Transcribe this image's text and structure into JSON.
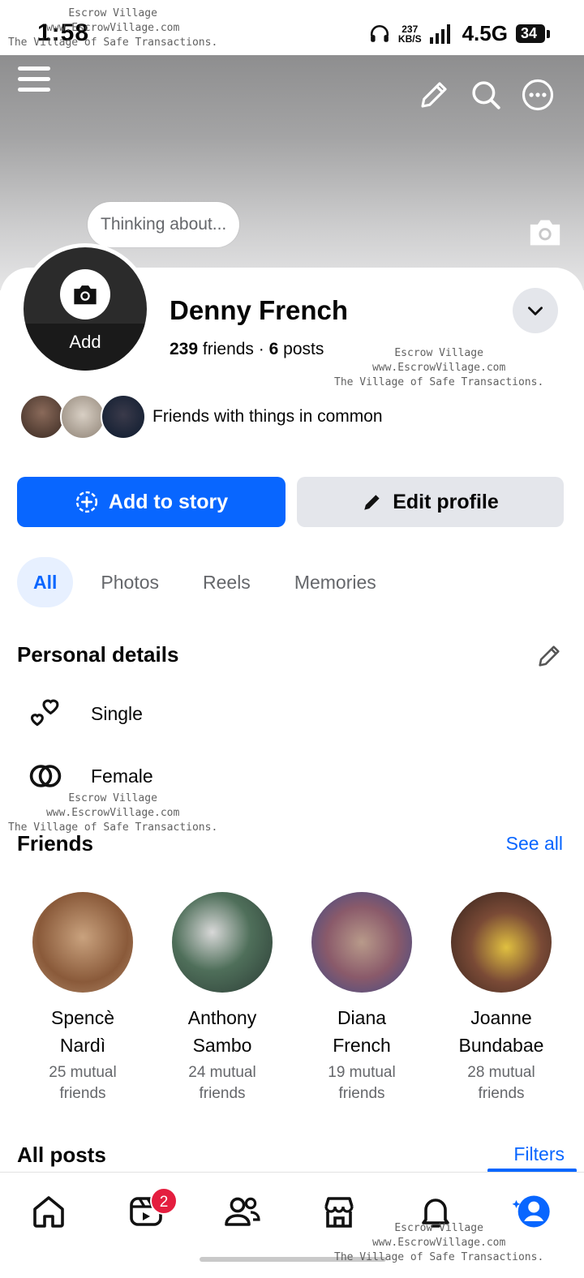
{
  "status_bar": {
    "time": "1:58",
    "speed": "237",
    "speed_unit": "KB/S",
    "network": "4.5G",
    "battery": "34"
  },
  "watermark": {
    "line1": "Escrow Village",
    "line2": "www.EscrowVillage.com",
    "line3": "The Village of Safe Transactions."
  },
  "cover": {
    "thought_placeholder": "Thinking about..."
  },
  "profile": {
    "avatar_label": "Add",
    "name": "Denny French",
    "friends_count": "239",
    "friends_word": "friends",
    "separator": "·",
    "posts_count": "6",
    "posts_word": "posts",
    "common_label": "Friends with things in common"
  },
  "actions": {
    "add_story": "Add to story",
    "edit_profile": "Edit profile"
  },
  "tabs": [
    "All",
    "Photos",
    "Reels",
    "Memories"
  ],
  "personal_details": {
    "title": "Personal details",
    "items": [
      {
        "icon": "relationship-hearts-icon",
        "label": "Single"
      },
      {
        "icon": "gender-rings-icon",
        "label": "Female"
      }
    ]
  },
  "friends_section": {
    "title": "Friends",
    "see_all": "See all",
    "friends": [
      {
        "first": "Spencè",
        "last": "Nardì",
        "mutual_1": "25 mutual",
        "mutual_2": "friends",
        "color": "#b08a6a"
      },
      {
        "first": "Anthony",
        "last": "Sambo",
        "mutual_1": "24 mutual",
        "mutual_2": "friends",
        "color": "#4f6f5a"
      },
      {
        "first": "Diana",
        "last": "French",
        "mutual_1": "19 mutual",
        "mutual_2": "friends",
        "color": "#8a5a6a"
      },
      {
        "first": "Joanne",
        "last": "Bundabae",
        "mutual_1": "28 mutual",
        "mutual_2": "friends",
        "color": "#5a3b2e"
      }
    ]
  },
  "posts_section": {
    "title": "All posts",
    "filters": "Filters"
  },
  "bottom_nav": {
    "video_badge": "2"
  },
  "colors": {
    "accent": "#0866ff",
    "badge": "#e41e3f",
    "secondary_bg": "#e4e6eb"
  }
}
